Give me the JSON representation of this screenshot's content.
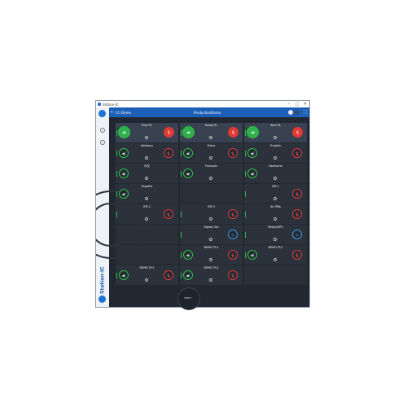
{
  "window": {
    "title": "Station-IC",
    "controls": [
      "–",
      "□",
      "✕"
    ]
  },
  "header": {
    "back_icon": "back-arrow-icon",
    "project": "CC-Demo",
    "center": "ProductionDemo",
    "grid_icon": "grid-icon"
  },
  "sidebar": {
    "brand": "Station-IC",
    "icons": [
      "user-icon",
      "gear-icon",
      "help-icon"
    ]
  },
  "cells": [
    {
      "name": "Prod PL",
      "talk": true,
      "mic": true,
      "col": 0,
      "row": 0
    },
    {
      "name": "Radio PL",
      "talk": true,
      "mic": true,
      "col": 1,
      "row": 0
    },
    {
      "name": "Tech PL",
      "talk": true,
      "mic": true,
      "col": 2,
      "row": 0
    },
    {
      "name": "Advisory",
      "talk": false,
      "mic": false,
      "col": 0,
      "row": 1
    },
    {
      "name": "Extra",
      "talk": false,
      "mic": false,
      "col": 1,
      "row": 1
    },
    {
      "name": "English",
      "talk": false,
      "mic": false,
      "col": 2,
      "row": 1
    },
    {
      "name": "中文",
      "talk": false,
      "mic": null,
      "col": 0,
      "row": 2
    },
    {
      "name": "Français",
      "talk": false,
      "mic": null,
      "col": 1,
      "row": 2
    },
    {
      "name": "Deutsche",
      "talk": false,
      "mic": null,
      "col": 2,
      "row": 2
    },
    {
      "name": "Español",
      "talk": false,
      "mic": null,
      "col": 0,
      "row": 3
    },
    {
      "name": "IFB 1",
      "talk": null,
      "mic": false,
      "col": 2,
      "row": 3
    },
    {
      "name": "IFB 2",
      "talk": null,
      "mic": false,
      "col": 0,
      "row": 4
    },
    {
      "name": "IFB 3",
      "talk": null,
      "mic": false,
      "col": 1,
      "row": 4
    },
    {
      "name": "All IFBs",
      "talk": null,
      "mic": false,
      "col": 2,
      "row": 4
    },
    {
      "name": "Signal Out",
      "talk": null,
      "mic": "blue",
      "col": 1,
      "row": 5
    },
    {
      "name": "Relay/GPO",
      "talk": null,
      "mic": "blue",
      "col": 2,
      "row": 5
    },
    {
      "name": "DEMO PL1",
      "talk": false,
      "mic": false,
      "col": 1,
      "row": 6
    },
    {
      "name": "DEMO PL2",
      "talk": false,
      "mic": false,
      "col": 2,
      "row": 6
    },
    {
      "name": "DEMO PL3",
      "talk": false,
      "mic": false,
      "col": 0,
      "row": 7
    },
    {
      "name": "DEMO PL4",
      "talk": false,
      "mic": false,
      "col": 1,
      "row": 7
    }
  ],
  "reply": {
    "label": "REPLY"
  },
  "colors": {
    "accent": "#1c5fb6",
    "talk": "#2fb04a",
    "mic": "#e03a35",
    "bg": "#222831"
  }
}
